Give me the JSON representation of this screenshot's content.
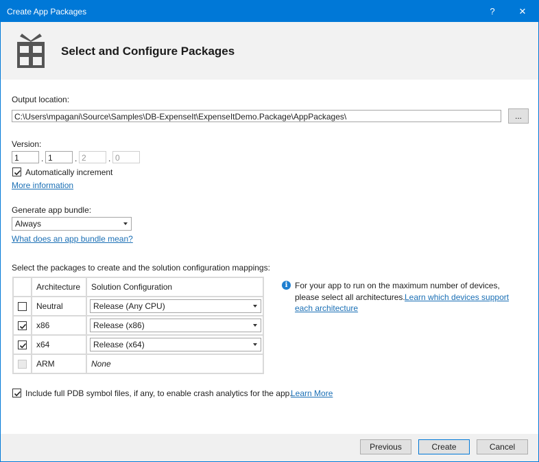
{
  "window": {
    "title": "Create App Packages",
    "help_glyph": "?",
    "close_glyph": "✕"
  },
  "header": {
    "title": "Select and Configure Packages",
    "icon": "package-icon"
  },
  "output": {
    "label": "Output location:",
    "path": "C:\\Users\\mpagani\\Source\\Samples\\DB-ExpenseIt\\ExpenseItDemo.Package\\AppPackages\\",
    "browse_label": "..."
  },
  "version": {
    "label": "Version:",
    "parts": [
      "1",
      "1",
      "2",
      "0"
    ],
    "separator": ".",
    "auto_increment_label": "Automatically increment",
    "auto_increment_checked": true,
    "more_info_link": "More information"
  },
  "bundle": {
    "label": "Generate app bundle:",
    "selected": "Always",
    "help_link": "What does an app bundle mean?"
  },
  "packages": {
    "label": "Select the packages to create and the solution configuration mappings:",
    "columns": [
      "",
      "Architecture",
      "Solution Configuration"
    ],
    "rows": [
      {
        "arch": "Neutral",
        "checked": false,
        "enabled": true,
        "config": "Release (Any CPU)"
      },
      {
        "arch": "x86",
        "checked": true,
        "enabled": true,
        "config": "Release (x86)"
      },
      {
        "arch": "x64",
        "checked": true,
        "enabled": true,
        "config": "Release (x64)"
      },
      {
        "arch": "ARM",
        "checked": false,
        "enabled": false,
        "config": "None"
      }
    ]
  },
  "info": {
    "line1": "For your app to run on the maximum number of devices,",
    "line2_text": "please select all architectures.",
    "line2_link": "Learn which devices support",
    "line3_link": "each architecture"
  },
  "pdb": {
    "label": "Include full PDB symbol files, if any, to enable crash analytics for the app.",
    "link": "Learn More",
    "checked": true
  },
  "footer": {
    "previous_label": "Previous",
    "create_label": "Create",
    "cancel_label": "Cancel"
  },
  "colors": {
    "titlebar": "#0078d7",
    "link": "#1a6fb5",
    "info": "#1e7fd0"
  }
}
